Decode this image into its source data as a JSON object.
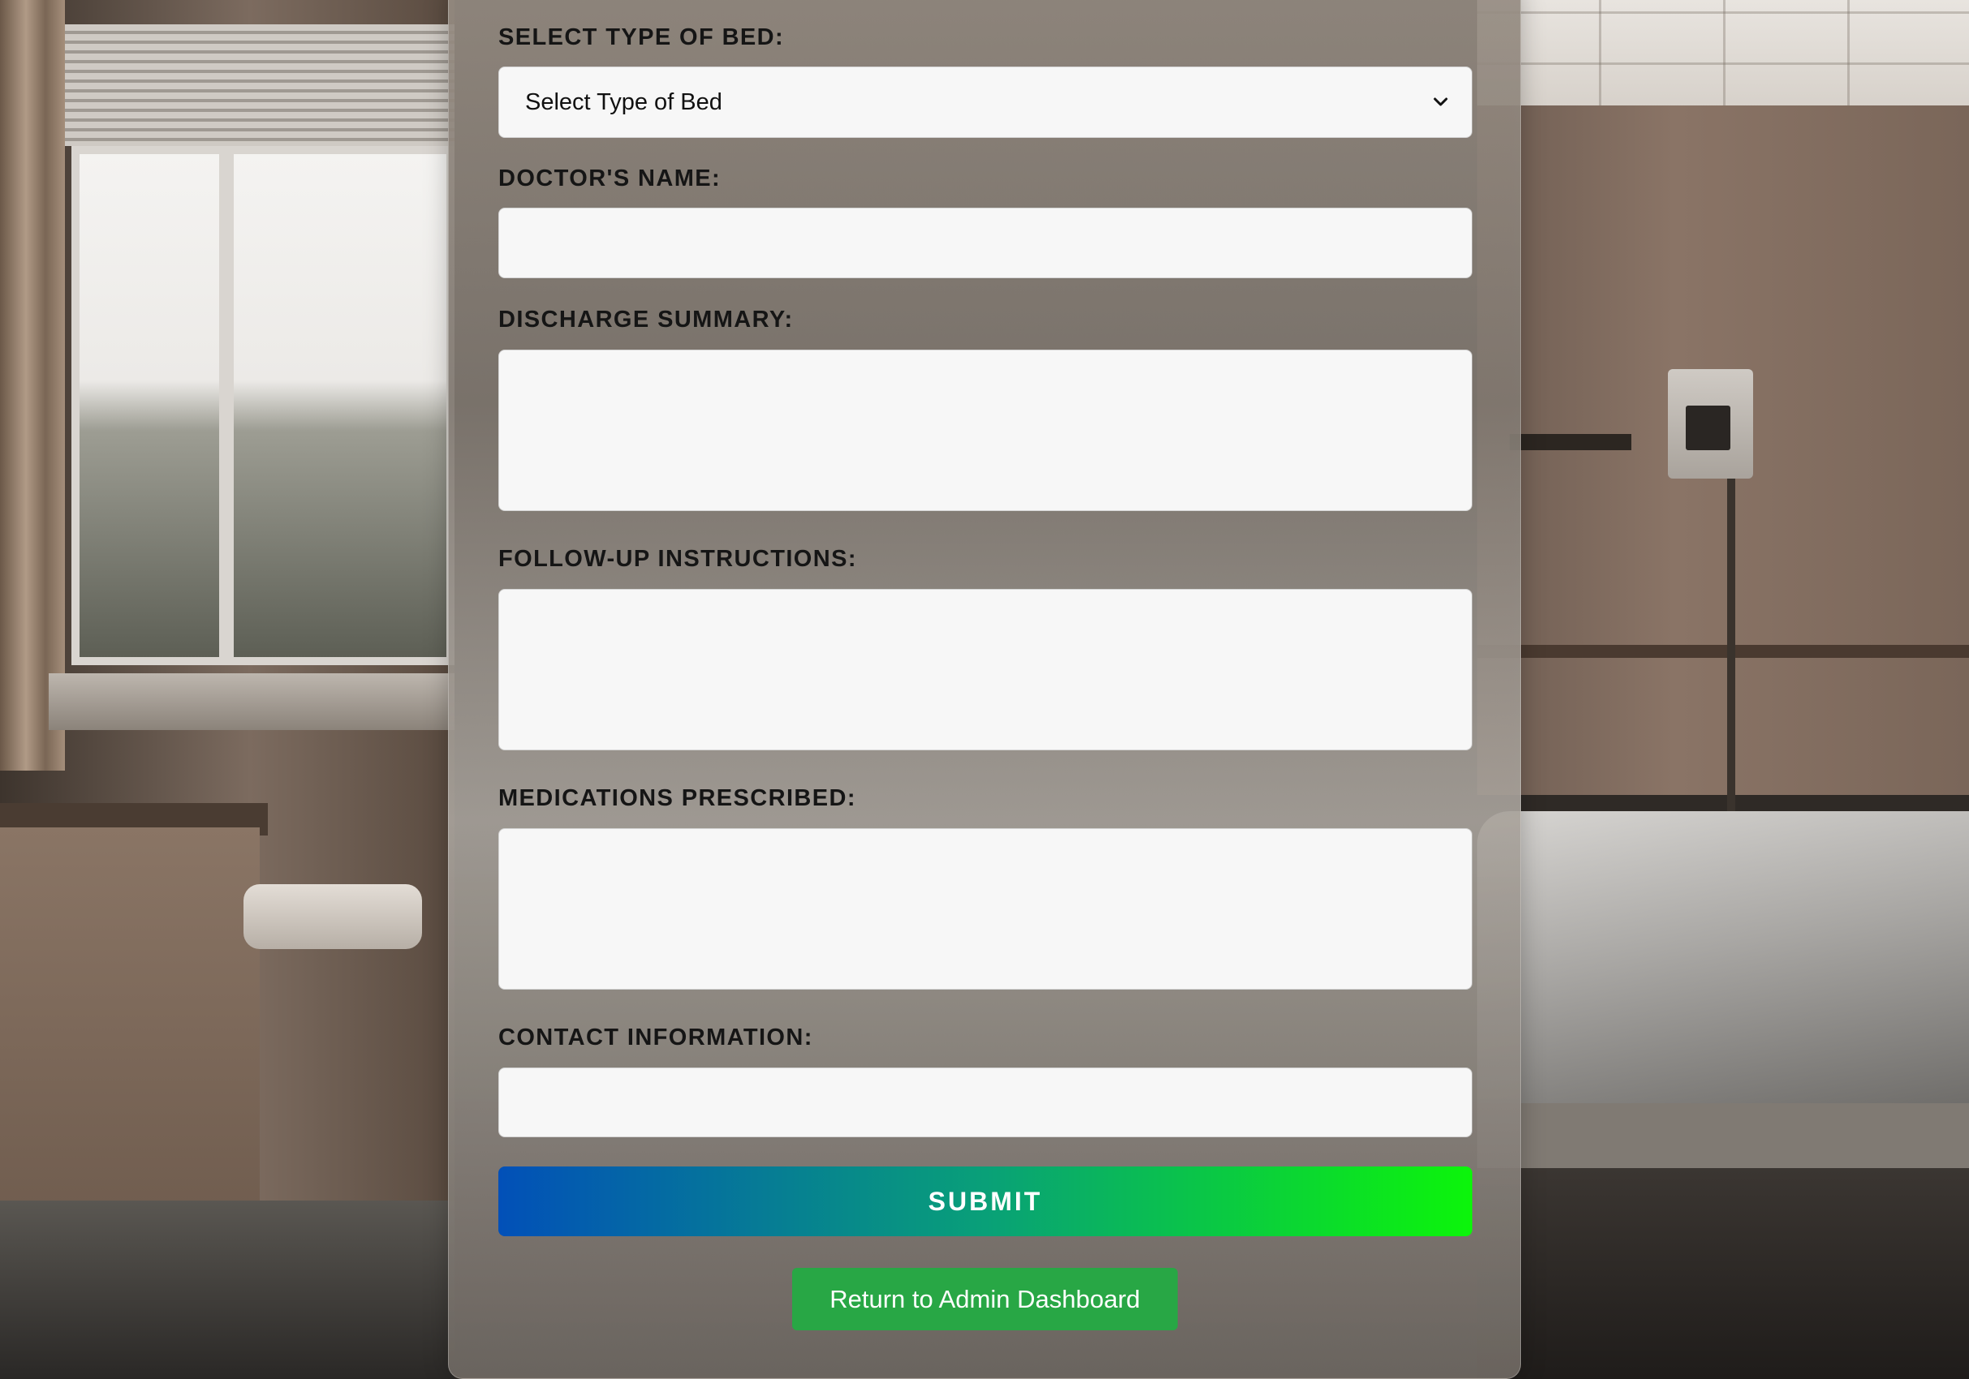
{
  "form": {
    "bed_type": {
      "label": "SELECT TYPE OF BED:",
      "selected": "Select Type of Bed",
      "icon": "chevron-down-icon"
    },
    "doctor_name": {
      "label": "DOCTOR'S NAME:",
      "value": ""
    },
    "discharge_summary": {
      "label": "DISCHARGE SUMMARY:",
      "value": ""
    },
    "follow_up": {
      "label": "FOLLOW-UP INSTRUCTIONS:",
      "value": ""
    },
    "medications": {
      "label": "MEDICATIONS PRESCRIBED:",
      "value": ""
    },
    "contact_info": {
      "label": "CONTACT INFORMATION:",
      "value": ""
    },
    "submit_label": "SUBMIT",
    "return_label": "Return to Admin Dashboard"
  },
  "colors": {
    "submit_gradient_start": "#0250b8",
    "submit_gradient_end": "#0cf50a",
    "return_button": "#28a745",
    "field_background": "#f7f7f7"
  }
}
